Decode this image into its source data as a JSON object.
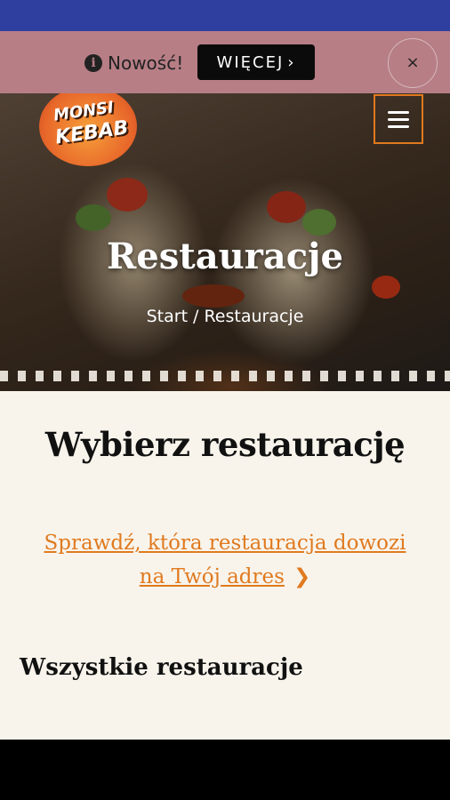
{
  "colors": {
    "status_bar": "#2f3f9f",
    "promo_bar": "#b77e86",
    "accent": "#e07a1f",
    "content_background": "#f8f4ec"
  },
  "promo": {
    "icon": "info-circle-icon",
    "text": "Nowość!",
    "button_label": "WIĘCEJ",
    "button_icon": "chevron-right-icon",
    "close_label": "×"
  },
  "header": {
    "logo": {
      "line1": "MONSI",
      "line2": "KEBAB"
    },
    "menu_icon": "hamburger-menu-icon"
  },
  "hero": {
    "title": "Restauracje",
    "breadcrumb": {
      "home": "Start",
      "separator": "/",
      "current": "Restauracje"
    }
  },
  "main": {
    "title": "Wybierz restaurację",
    "delivery_link": "Sprawdź, która restauracja dowozi na Twój adres",
    "delivery_icon": "chevron-right-icon",
    "section_title": "Wszystkie restauracje"
  }
}
